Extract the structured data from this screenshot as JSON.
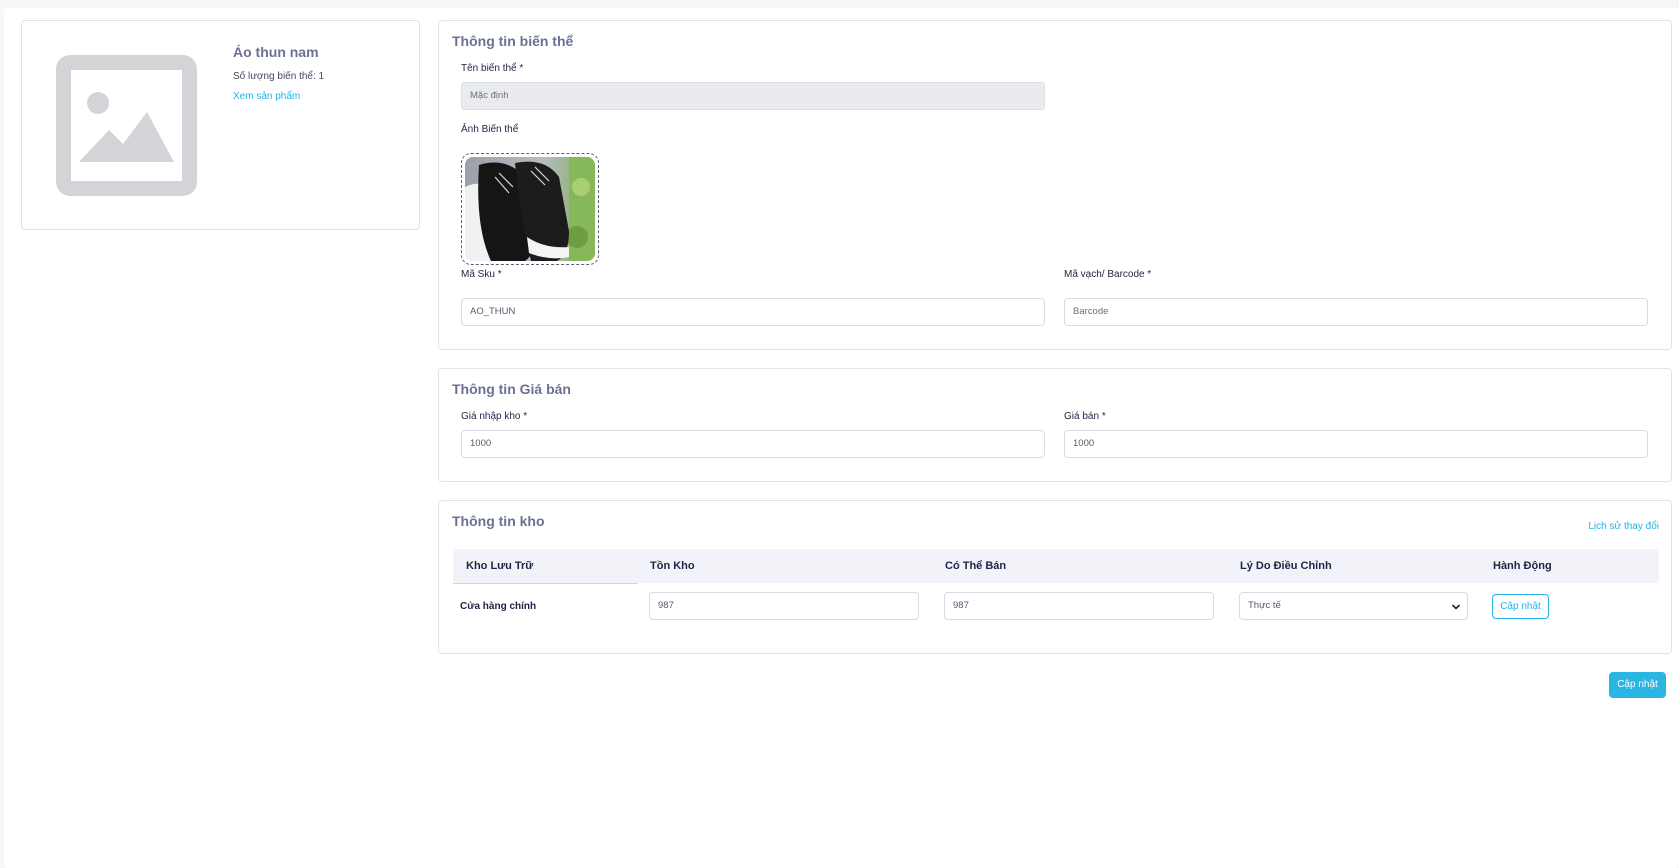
{
  "product": {
    "name": "Áo thun nam",
    "variant_count": "Số lượng biến thể: 1",
    "view_product_link": "Xem sản phẩm"
  },
  "variant": {
    "title": "Thông tin biến thể",
    "name_label": "Tên biến thể",
    "name_value": "Mặc định",
    "image_label": "Ảnh Biến thể",
    "sku_label": "Mã Sku",
    "sku_value": "AO_THUN",
    "barcode_label": "Mã vạch/ Barcode",
    "barcode_placeholder": "Barcode",
    "required_mark": "*"
  },
  "price": {
    "title": "Thông tin Giá bán",
    "import_label": "Giá nhập kho",
    "import_value": "1000",
    "sale_label": "Giá bán",
    "sale_value": "1000",
    "required_mark": "*"
  },
  "stock": {
    "title": "Thông tin kho",
    "history_link": "Lịch sử thay đổi",
    "columns": [
      "Kho Lưu Trữ",
      "Tồn Kho",
      "Có Thể Bán",
      "Lý Do Điều Chỉnh",
      "Hành Động"
    ],
    "rows": [
      {
        "warehouse": "Cửa hàng chính",
        "on_hand": "987",
        "available": "987",
        "reason": "Thực tế",
        "action": "Cập nhật"
      }
    ]
  },
  "footer": {
    "update_button": "Cập nhật"
  },
  "colors": {
    "accent": "#23b3e6",
    "title": "#6b7290",
    "text": "#1f2344"
  }
}
